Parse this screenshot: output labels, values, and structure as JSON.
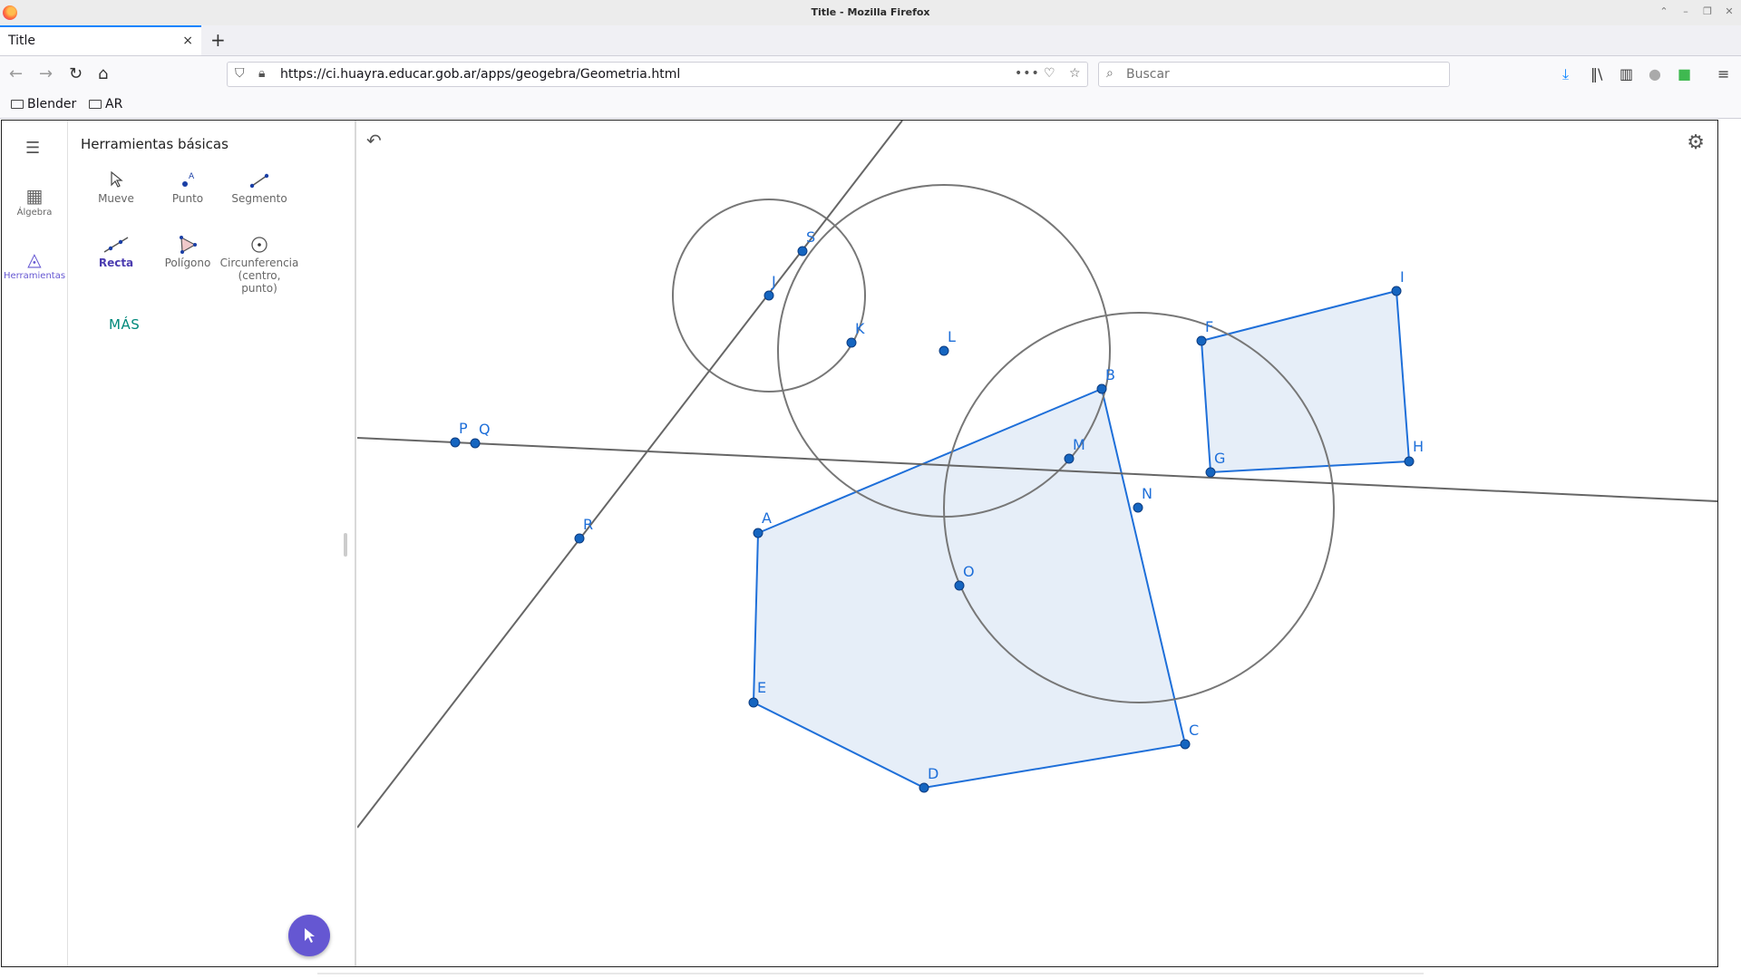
{
  "window": {
    "title": "Title - Mozilla Firefox"
  },
  "tab": {
    "title": "Title",
    "close": "×"
  },
  "navbar": {
    "url": "https://ci.huayra.educar.gob.ar/apps/geogebra/Geometria.html",
    "search_placeholder": "Buscar"
  },
  "bookmarks": [
    {
      "label": "Blender"
    },
    {
      "label": "AR"
    }
  ],
  "rail": {
    "items": [
      {
        "label": "Álgebra",
        "icon": "calculator-icon"
      },
      {
        "label": "Herramientas",
        "icon": "shapes-icon"
      }
    ]
  },
  "tools": {
    "title": "Herramientas básicas",
    "items": [
      {
        "label": "Mueve",
        "icon": "cursor-icon"
      },
      {
        "label": "Punto",
        "icon": "point-icon"
      },
      {
        "label": "Segmento",
        "icon": "segment-icon"
      },
      {
        "label": "Recta",
        "icon": "line-icon"
      },
      {
        "label": "Polígono",
        "icon": "polygon-icon"
      },
      {
        "label": "Circunferencia (centro, punto)",
        "icon": "circle-icon"
      }
    ],
    "more": "MÁS"
  },
  "colors": {
    "accent": "#6557d2",
    "point": "#1565c0",
    "polygon_fill": "#e6eef8",
    "polygon_stroke": "#1e6fd9",
    "line": "#666666",
    "more": "#00897b"
  },
  "geometry": {
    "points": [
      "A",
      "B",
      "C",
      "D",
      "E",
      "F",
      "G",
      "H",
      "I",
      "J",
      "K",
      "L",
      "M",
      "N",
      "O",
      "P",
      "Q",
      "R",
      "S"
    ]
  }
}
